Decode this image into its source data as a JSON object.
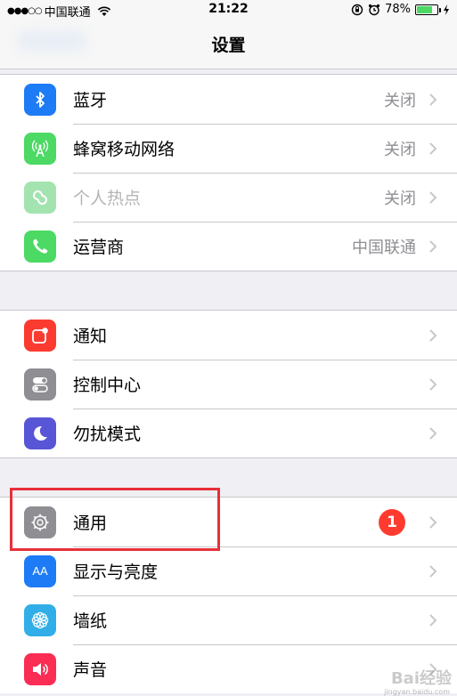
{
  "status_bar": {
    "signal": "●●●○○",
    "carrier": "中国联通",
    "time": "21:22",
    "battery_percent": "78%",
    "battery_level": 0.78
  },
  "nav": {
    "title": "设置"
  },
  "groups": [
    {
      "rows": [
        {
          "label": "蓝牙",
          "value": "关闭",
          "icon": "bluetooth-icon",
          "color": "#1e7bf6"
        },
        {
          "label": "蜂窝移动网络",
          "value": "关闭",
          "icon": "cellular-icon",
          "color": "#4cd964"
        },
        {
          "label": "个人热点",
          "value": "关闭",
          "icon": "hotspot-icon",
          "color": "#a3e3b0"
        },
        {
          "label": "运营商",
          "value": "中国联通",
          "icon": "phone-icon",
          "color": "#4cd964"
        }
      ]
    },
    {
      "rows": [
        {
          "label": "通知",
          "icon": "notifications-icon",
          "color": "#fb3b30"
        },
        {
          "label": "控制中心",
          "icon": "control-center-icon",
          "color": "#8e8e93"
        },
        {
          "label": "勿扰模式",
          "icon": "moon-icon",
          "color": "#5856d6"
        }
      ]
    },
    {
      "rows": [
        {
          "label": "通用",
          "badge": "1",
          "icon": "gear-icon",
          "color": "#8e8e93"
        },
        {
          "label": "显示与亮度",
          "icon": "display-icon",
          "color": "#1e7bf6",
          "icon_text": "AA"
        },
        {
          "label": "墙纸",
          "icon": "wallpaper-icon",
          "color": "#31aee8"
        },
        {
          "label": "声音",
          "icon": "sound-icon",
          "color": "#fb2d55"
        }
      ]
    }
  ],
  "watermark": {
    "text": "Bai经验",
    "sub": "jingyan.baidu.com"
  }
}
